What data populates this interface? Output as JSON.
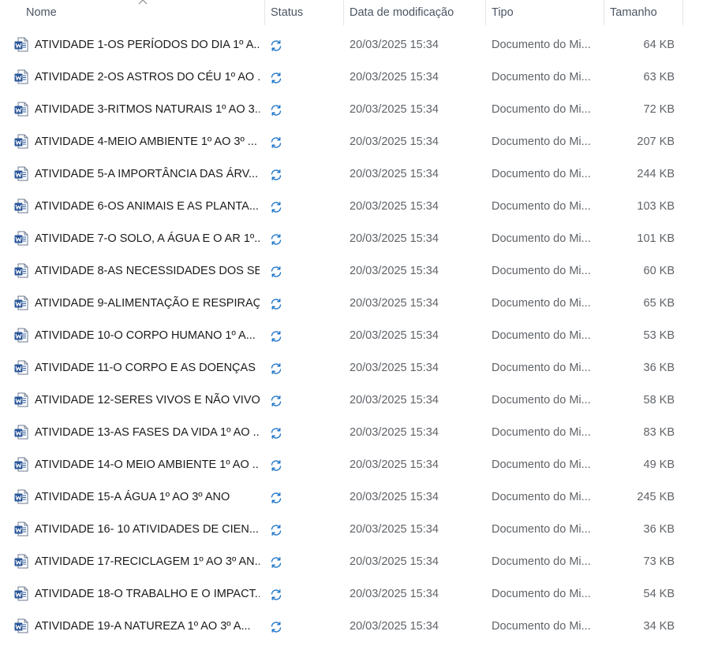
{
  "columns": {
    "name": "Nome",
    "status": "Status",
    "modified": "Data de modificação",
    "type": "Tipo",
    "size": "Tamanho"
  },
  "colors": {
    "sync_icon": "#1a73c7",
    "word_icon": "#2b579a"
  },
  "files": [
    {
      "name": "ATIVIDADE 1-OS PERÍODOS DO DIA 1º A...",
      "date": "20/03/2025 15:34",
      "type": "Documento do Mi...",
      "size": "64 KB"
    },
    {
      "name": "ATIVIDADE 2-OS ASTROS DO CÉU 1º AO ...",
      "date": "20/03/2025 15:34",
      "type": "Documento do Mi...",
      "size": "63 KB"
    },
    {
      "name": "ATIVIDADE 3-RITMOS NATURAIS 1º AO 3...",
      "date": "20/03/2025 15:34",
      "type": "Documento do Mi...",
      "size": "72 KB"
    },
    {
      "name": "ATIVIDADE 4-MEIO AMBIENTE 1º AO 3º ...",
      "date": "20/03/2025 15:34",
      "type": "Documento do Mi...",
      "size": "207 KB"
    },
    {
      "name": "ATIVIDADE 5-A IMPORTÂNCIA DAS ÁRV...",
      "date": "20/03/2025 15:34",
      "type": "Documento do Mi...",
      "size": "244 KB"
    },
    {
      "name": "ATIVIDADE 6-OS ANIMAIS E AS PLANTA...",
      "date": "20/03/2025 15:34",
      "type": "Documento do Mi...",
      "size": "103 KB"
    },
    {
      "name": "ATIVIDADE 7-O SOLO, A ÁGUA E O AR 1º...",
      "date": "20/03/2025 15:34",
      "type": "Documento do Mi...",
      "size": "101 KB"
    },
    {
      "name": "ATIVIDADE 8-AS NECESSIDADES DOS SE...",
      "date": "20/03/2025 15:34",
      "type": "Documento do Mi...",
      "size": "60 KB"
    },
    {
      "name": "ATIVIDADE 9-ALIMENTAÇÃO E RESPIRAÇ...",
      "date": "20/03/2025 15:34",
      "type": "Documento do Mi...",
      "size": "65 KB"
    },
    {
      "name": "ATIVIDADE 10-O CORPO HUMANO 1º A...",
      "date": "20/03/2025 15:34",
      "type": "Documento do Mi...",
      "size": "53 KB"
    },
    {
      "name": "ATIVIDADE 11-O CORPO E AS DOENÇAS ...",
      "date": "20/03/2025 15:34",
      "type": "Documento do Mi...",
      "size": "36 KB"
    },
    {
      "name": "ATIVIDADE 12-SERES VIVOS E NÃO VIVO...",
      "date": "20/03/2025 15:34",
      "type": "Documento do Mi...",
      "size": "58 KB"
    },
    {
      "name": "ATIVIDADE 13-AS FASES DA VIDA 1º AO ...",
      "date": "20/03/2025 15:34",
      "type": "Documento do Mi...",
      "size": "83 KB"
    },
    {
      "name": "ATIVIDADE 14-O MEIO AMBIENTE 1º AO ...",
      "date": "20/03/2025 15:34",
      "type": "Documento do Mi...",
      "size": "49 KB"
    },
    {
      "name": "ATIVIDADE 15-A ÁGUA 1º AO 3º ANO",
      "date": "20/03/2025 15:34",
      "type": "Documento do Mi...",
      "size": "245 KB"
    },
    {
      "name": "ATIVIDADE 16- 10 ATIVIDADES DE CIEN...",
      "date": "20/03/2025 15:34",
      "type": "Documento do Mi...",
      "size": "36 KB"
    },
    {
      "name": "ATIVIDADE 17-RECICLAGEM 1º AO 3º AN...",
      "date": "20/03/2025 15:34",
      "type": "Documento do Mi...",
      "size": "73 KB"
    },
    {
      "name": "ATIVIDADE 18-O TRABALHO E O IMPACT...",
      "date": "20/03/2025 15:34",
      "type": "Documento do Mi...",
      "size": "54 KB"
    },
    {
      "name": "ATIVIDADE 19-A NATUREZA 1º AO 3º A...",
      "date": "20/03/2025 15:34",
      "type": "Documento do Mi...",
      "size": "34 KB"
    }
  ]
}
